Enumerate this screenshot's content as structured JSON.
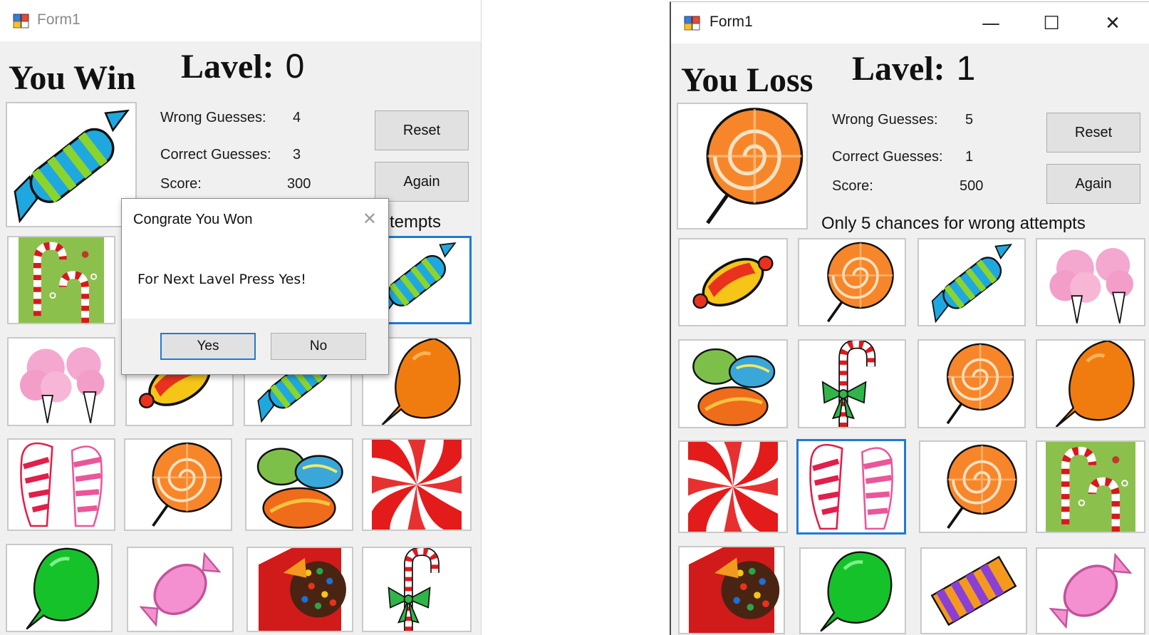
{
  "left_window": {
    "title": "Form1",
    "result": "You Win",
    "level_label": "Lavel:",
    "level_value": "0",
    "wrong_label": "Wrong Guesses:",
    "wrong_value": "4",
    "correct_label": "Correct Guesses:",
    "correct_value": "3",
    "score_label": "Score:",
    "score_value": "300",
    "reset_label": "Reset",
    "again_label": "Again",
    "chances_partial": "tempts",
    "preview_icon": "blue-wrapped-candy",
    "tiles": [
      "candy-canes-green",
      "hidden",
      "hidden",
      "blue-wrapped-candy",
      "cotton-candy",
      "striped-wrapped-candy",
      "blue-wrapped-candy",
      "orange-balloon-lollipop",
      "pink-horn-candy",
      "orange-swirl-lollipop",
      "jelly-beans",
      "red-peppermint-swirl",
      "green-balloon-lollipop",
      "pink-wrapped-candy",
      "chocolate-sprinkle-candy",
      "candy-cane-bow"
    ]
  },
  "dialog": {
    "title": "Congrate You Won",
    "message": "For Next Lavel Press Yes!",
    "yes_label": "Yes",
    "no_label": "No"
  },
  "right_window": {
    "title": "Form1",
    "result": "You Loss",
    "level_label": "Lavel:",
    "level_value": "1",
    "wrong_label": "Wrong Guesses:",
    "wrong_value": "5",
    "correct_label": "Correct Guesses:",
    "correct_value": "1",
    "score_label": "Score:",
    "score_value": "500",
    "reset_label": "Reset",
    "again_label": "Again",
    "chances": "Only 5 chances for wrong attempts",
    "preview_icon": "orange-swirl-lollipop",
    "tiles": [
      "striped-wrapped-candy",
      "orange-swirl-lollipop",
      "blue-wrapped-candy",
      "cotton-candy",
      "jelly-beans",
      "candy-cane-bow",
      "orange-swirl-lollipop",
      "orange-balloon-lollipop",
      "red-peppermint-swirl",
      "pink-horn-candy",
      "orange-swirl-lollipop",
      "candy-canes-green",
      "chocolate-sprinkle-candy",
      "green-balloon-lollipop",
      "purple-striped-candy",
      "pink-wrapped-candy"
    ],
    "selected_tile": 9
  },
  "colors": {
    "selection": "#1e7bd6",
    "form_bg": "#f0f0f0",
    "button_bg": "#e1e1e1"
  }
}
